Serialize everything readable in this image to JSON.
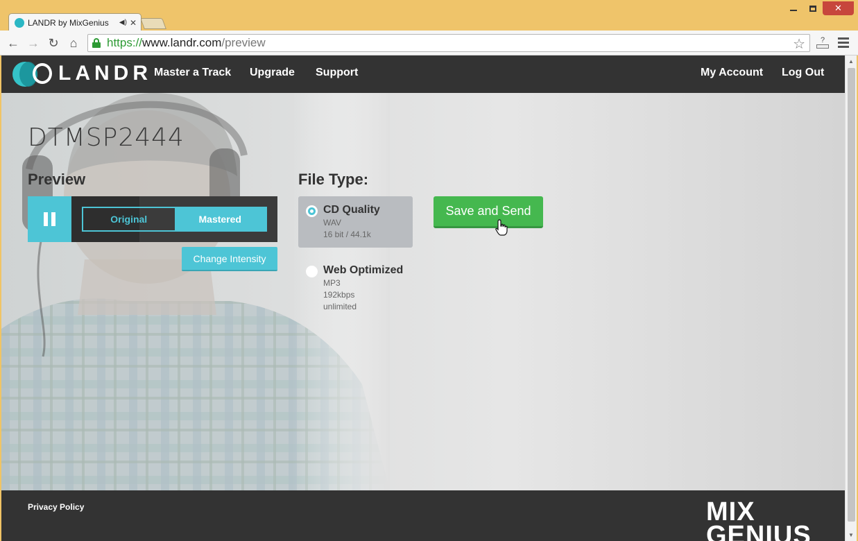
{
  "browser": {
    "tab_title": "LANDR by MixGenius",
    "url_scheme": "https://",
    "url_host": "www.landr.com",
    "url_path": "/preview"
  },
  "header": {
    "logo_text": "LANDR",
    "nav": [
      "Master a Track",
      "Upgrade",
      "Support"
    ],
    "account": "My Account",
    "logout": "Log Out"
  },
  "main": {
    "track_name": "DTMSP2444",
    "preview_title": "Preview",
    "toggle_original": "Original",
    "toggle_mastered": "Mastered",
    "change_intensity": "Change Intensity",
    "filetype_title": "File Type:",
    "options": [
      {
        "name": "CD Quality",
        "lines": [
          "WAV",
          "16 bit / 44.1k"
        ],
        "selected": true
      },
      {
        "name": "Web Optimized",
        "lines": [
          "MP3",
          "192kbps",
          "unlimited"
        ],
        "selected": false
      }
    ],
    "save_button": "Save and Send"
  },
  "footer": {
    "privacy": "Privacy Policy",
    "brand_line1": "MIX",
    "brand_line2": "GENIUS"
  },
  "colors": {
    "accent": "#4dc5d6",
    "header_bg": "#333333",
    "save_green": "#45b84f"
  }
}
